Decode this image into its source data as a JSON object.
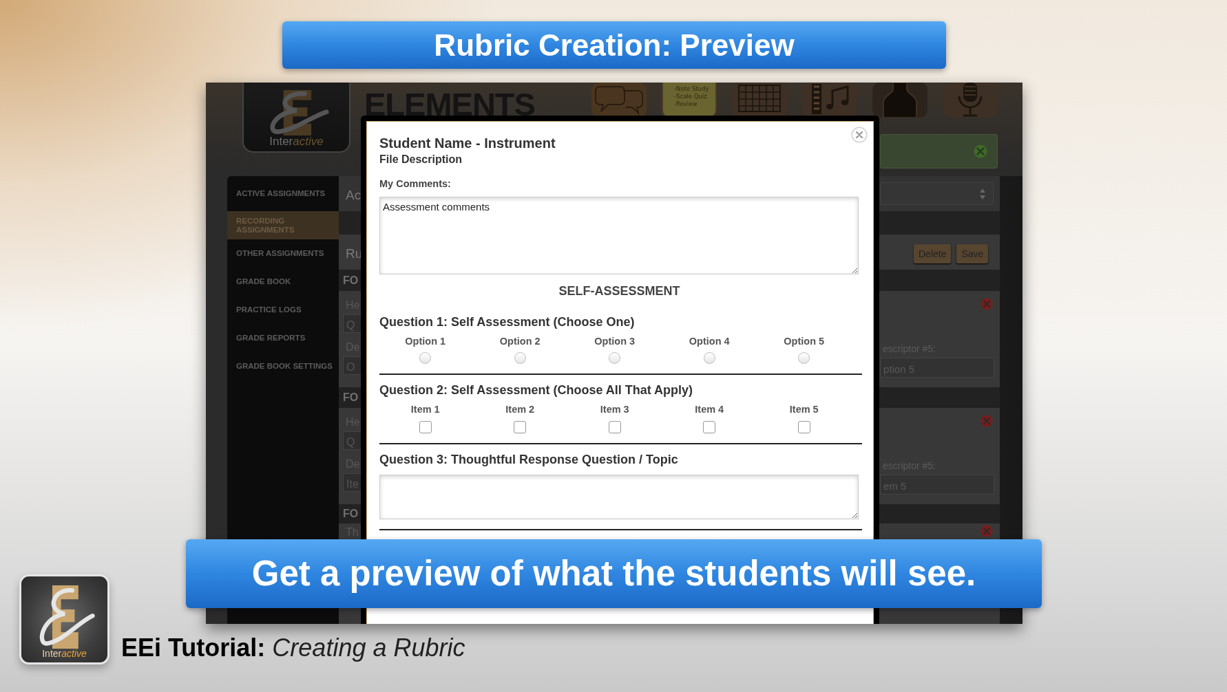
{
  "slide": {
    "title": "Rubric Creation: Preview",
    "caption": "Get a preview of what the students will see.",
    "footer_logo_text": {
      "plain": "Inter",
      "accent": "active"
    },
    "footer": "**EEi Tutorial:** *Creating a Rubric*"
  },
  "app": {
    "header": {
      "logo_text": {
        "plain": "Inter",
        "accent": "active"
      },
      "brand": "ELEMENTS",
      "notepad_lines": [
        "-Note Study",
        "-Scale Quiz",
        "-Review"
      ]
    },
    "sidebar": {
      "items": [
        {
          "label": "ACTIVE ASSIGNMENTS",
          "selected": false
        },
        {
          "label": "RECORDING ASSIGNMENTS",
          "selected": true
        },
        {
          "label": "OTHER ASSIGNMENTS",
          "selected": false
        },
        {
          "label": "GRADE BOOK",
          "selected": false
        },
        {
          "label": "PRACTICE LOGS",
          "selected": false
        },
        {
          "label": "GRADE REPORTS",
          "selected": false
        },
        {
          "label": "GRADE BOOK SETTINGS",
          "selected": false
        }
      ]
    },
    "page": {
      "heading": "Ac",
      "subheading": "Ru",
      "buttons": [
        "Delete",
        "Save"
      ],
      "sections": [
        {
          "heading": "FO",
          "fields": [
            {
              "label": "He",
              "value": "Q"
            },
            {
              "label": "De",
              "value": "O"
            }
          ],
          "right_label": "escriptor #5:",
          "right_value": "ption 5"
        },
        {
          "heading": "FO",
          "fields": [
            {
              "label": "He",
              "value": "Q"
            },
            {
              "label": "De",
              "value": "Ite"
            }
          ],
          "right_label": "escriptor #5:",
          "right_value": "em 5"
        },
        {
          "heading": "FO",
          "fields": [
            {
              "label": "Th"
            }
          ]
        }
      ]
    }
  },
  "modal": {
    "title": "Student Name - Instrument",
    "subtitle": "File Description",
    "comments_label": "My Comments:",
    "comments_value": "Assessment comments",
    "section_title": "SELF-ASSESSMENT",
    "questions": [
      {
        "kind": "single",
        "title": "Question 1: Self Assessment (Choose One)",
        "options": [
          {
            "label": "Option 1",
            "selected": false
          },
          {
            "label": "Option 2",
            "selected": false
          },
          {
            "label": "Option 3",
            "selected": false
          },
          {
            "label": "Option 4",
            "selected": false
          },
          {
            "label": "Option 5",
            "selected": false
          }
        ]
      },
      {
        "kind": "multi",
        "title": "Question 2: Self Assessment (Choose All That Apply)",
        "options": [
          {
            "label": "Item 1",
            "checked": false
          },
          {
            "label": "Item 2",
            "checked": false
          },
          {
            "label": "Item 3",
            "checked": false
          },
          {
            "label": "Item 4",
            "checked": false
          },
          {
            "label": "Item 5",
            "checked": false
          }
        ]
      },
      {
        "kind": "text",
        "title": "Question 3: Thoughtful Response Question / Topic"
      }
    ]
  }
}
